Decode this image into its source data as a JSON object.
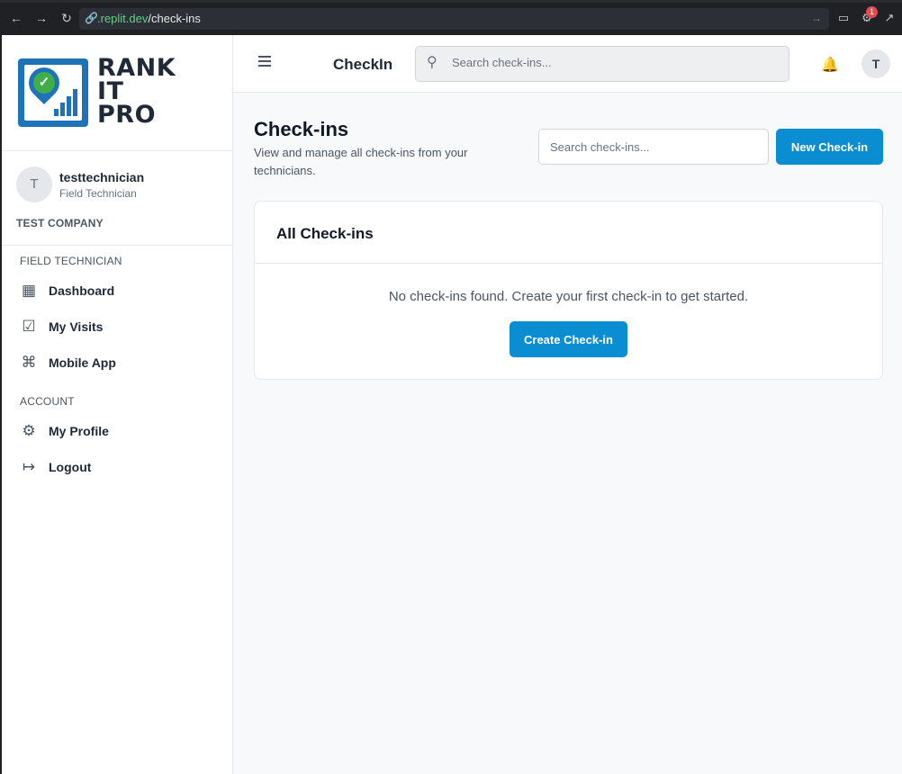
{
  "browser": {
    "url_domain": ".replit.dev",
    "url_path": "/check-ins",
    "notification_count": "1"
  },
  "sidebar": {
    "logo_lines": [
      "RANK",
      "IT",
      "PRO"
    ],
    "user": {
      "avatar_initial": "T",
      "name": "testtechnician",
      "role": "Field Technician",
      "company": "TEST COMPANY"
    },
    "sections": [
      {
        "label": "FIELD TECHNICIAN",
        "items": [
          {
            "label": "Dashboard",
            "icon": "grid-icon"
          },
          {
            "label": "My Visits",
            "icon": "checkbox-icon"
          },
          {
            "label": "Mobile App",
            "icon": "command-icon"
          }
        ]
      },
      {
        "label": "ACCOUNT",
        "items": [
          {
            "label": "My Profile",
            "icon": "gear-icon"
          },
          {
            "label": "Logout",
            "icon": "logout-icon"
          }
        ]
      }
    ]
  },
  "header": {
    "app_title": "CheckIn",
    "search_placeholder": "Search check-ins...",
    "avatar_initial": "T"
  },
  "main": {
    "title": "Check-ins",
    "subtitle": "View and manage all check-ins from your technicians.",
    "search_placeholder": "Search check-ins...",
    "new_button_label": "New Check-in",
    "card": {
      "title": "All Check-ins",
      "empty_message": "No check-ins found. Create your first check-in to get started.",
      "create_button_label": "Create Check-in"
    }
  },
  "colors": {
    "primary": "#0a8ed1",
    "brand_blue": "#1e73b8",
    "brand_green": "#3fae49"
  }
}
